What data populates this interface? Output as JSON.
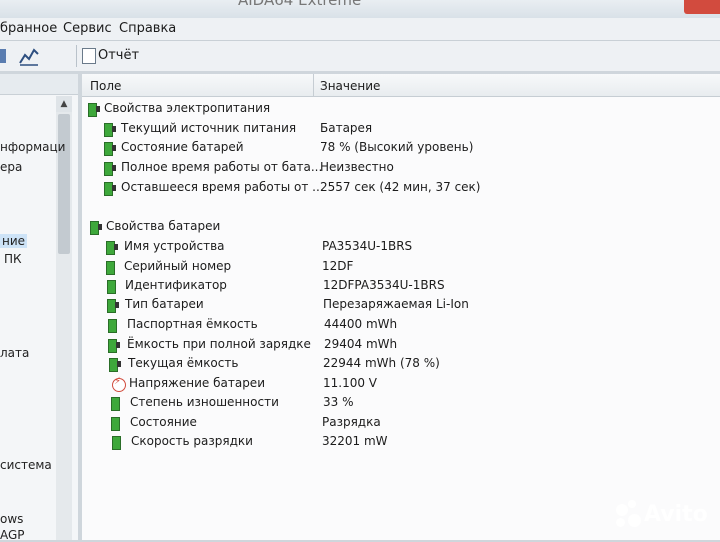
{
  "window": {
    "title": "AIDA64 Extreme"
  },
  "menu": [
    "бранное",
    "Сервис",
    "Справка"
  ],
  "toolbar": {
    "report_label": "Отчёт"
  },
  "left_pane": {
    "items": [
      "нформаци",
      "ера",
      "ние",
      "ПК",
      "лата",
      "система",
      "ows",
      "AGP"
    ]
  },
  "columns": {
    "field": "Поле",
    "value": "Значение"
  },
  "power": {
    "title": "Свойства электропитания",
    "rows": [
      {
        "field": "Текущий источник питания",
        "value": "Батарея"
      },
      {
        "field": "Состояние батарей",
        "value": "78 % (Высокий уровень)"
      },
      {
        "field": "Полное время работы от бата...",
        "value": "Неизвестно"
      },
      {
        "field": "Оставшееся время работы от ...",
        "value": "2557 сек (42 мин, 37 сек)"
      }
    ]
  },
  "battery": {
    "title": "Свойства батареи",
    "rows": [
      {
        "field": "Имя устройства",
        "value": "PA3534U-1BRS"
      },
      {
        "field": "Серийный номер",
        "value": "12DF"
      },
      {
        "field": "Идентификатор",
        "value": "12DFPA3534U-1BRS"
      },
      {
        "field": "Тип батареи",
        "value": "Перезаряжаемая Li-Ion"
      },
      {
        "field": "Паспортная ёмкость",
        "value": "44400 mWh"
      },
      {
        "field": "Ёмкость при полной зарядке",
        "value": "29404 mWh"
      },
      {
        "field": "Текущая ёмкость",
        "value": "22944 mWh  (78 %)"
      },
      {
        "field": "Напряжение батареи",
        "value": "11.100 V"
      },
      {
        "field": "Степень изношенности",
        "value": "33 %"
      },
      {
        "field": "Состояние",
        "value": "Разрядка"
      },
      {
        "field": "Скорость разрядки",
        "value": "32201 mW"
      }
    ]
  },
  "watermark": {
    "text": "Avito"
  },
  "colors": {
    "battery_green": "#3ea83b",
    "warning_red": "#d14b3d",
    "close_red": "#d24b3e"
  }
}
